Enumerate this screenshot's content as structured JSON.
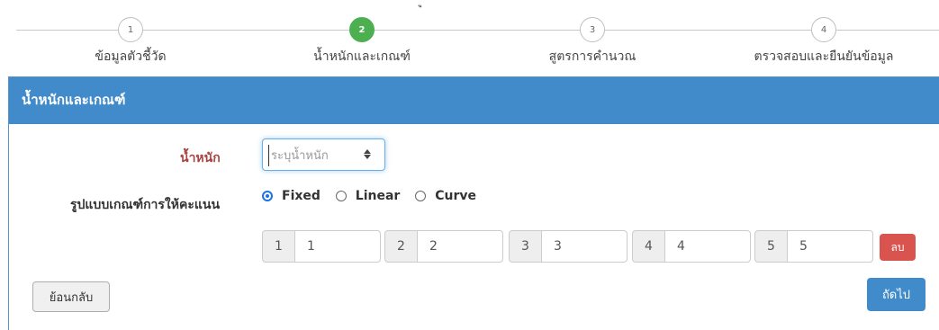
{
  "top_mark": "ู",
  "stepper": {
    "steps": [
      {
        "number": "1",
        "label": "ข้อมูลตัวชี้วัด",
        "active": false
      },
      {
        "number": "2",
        "label": "น้ำหนักและเกณฑ์",
        "active": true
      },
      {
        "number": "3",
        "label": "สูตรการคำนวณ",
        "active": false
      },
      {
        "number": "4",
        "label": "ตรวจสอบและยืนยันข้อมูล",
        "active": false
      }
    ]
  },
  "panel": {
    "title": "น้ำหนักและเกณฑ์",
    "weight": {
      "label": "น้ำหนัก",
      "placeholder": "ระบุน้ำหนัก",
      "value": ""
    },
    "criteria": {
      "label": "รูปแบบเกณฑ์การให้คะแนน",
      "options": [
        {
          "label": "Fixed",
          "checked": true
        },
        {
          "label": "Linear",
          "checked": false
        },
        {
          "label": "Curve",
          "checked": false
        }
      ]
    },
    "levels": [
      {
        "addon": "1",
        "value": "1"
      },
      {
        "addon": "2",
        "value": "2"
      },
      {
        "addon": "3",
        "value": "3"
      },
      {
        "addon": "4",
        "value": "4"
      },
      {
        "addon": "5",
        "value": "5"
      }
    ],
    "delete_label": "ลบ",
    "back_label": "ย้อนกลับ",
    "next_label": "ถัดไป"
  },
  "colors": {
    "active_step": "#4caf50",
    "panel_heading": "#428bca",
    "required_label": "#a94442",
    "delete_button": "#d9534f",
    "next_button": "#428bca"
  }
}
